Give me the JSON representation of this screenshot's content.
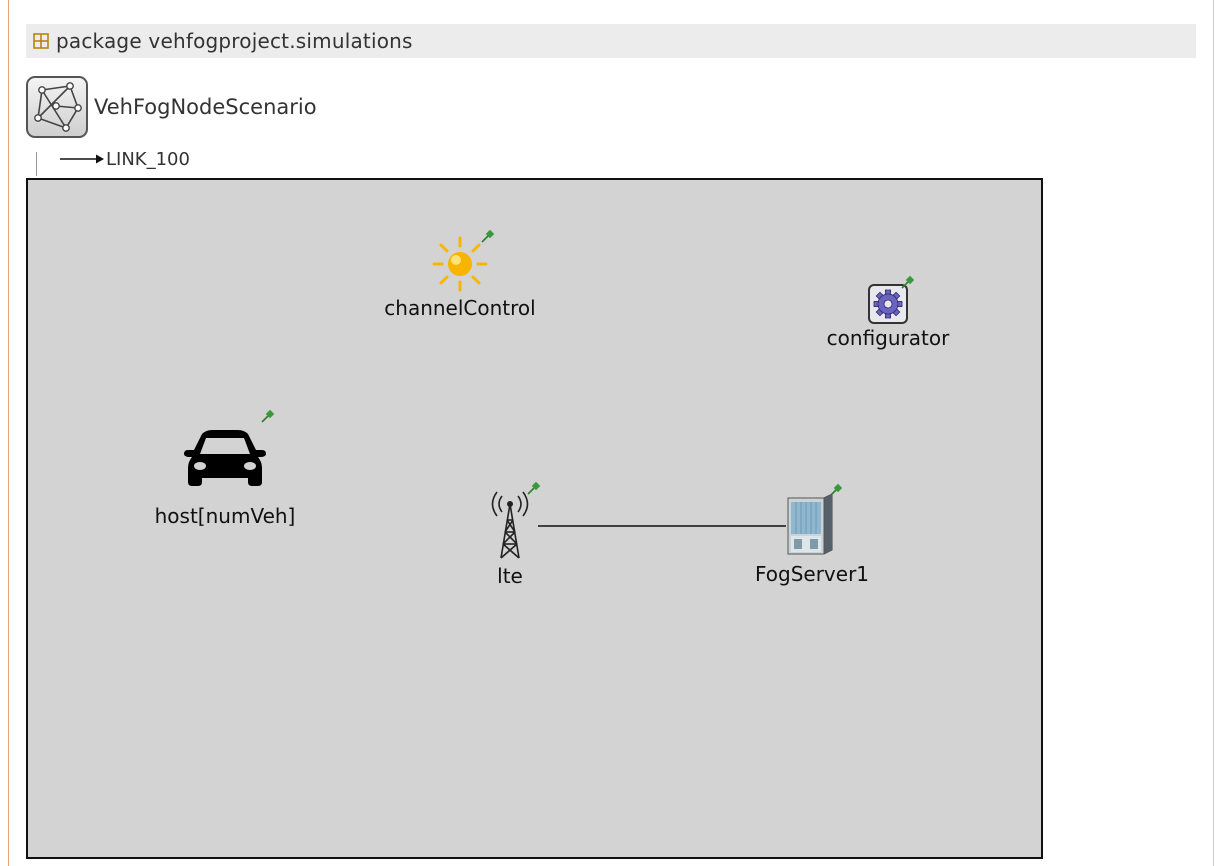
{
  "package": {
    "keyword": "package",
    "name": "vehfogproject.simulations",
    "icon": "package-icon"
  },
  "module": {
    "name": "VehFogNodeScenario",
    "icon": "network-icon"
  },
  "link": {
    "label": "LINK_100",
    "icon": "arrow-right-icon"
  },
  "nodes": {
    "channelControl": {
      "label": "channelControl",
      "icon": "sun-icon"
    },
    "configurator": {
      "label": "configurator",
      "icon": "gear-icon"
    },
    "host": {
      "label": "host[numVeh]",
      "icon": "car-icon"
    },
    "lte": {
      "label": "lte",
      "icon": "antenna-tower-icon"
    },
    "fogServer": {
      "label": "FogServer1",
      "icon": "server-icon"
    }
  },
  "connections": [
    {
      "from": "lte",
      "to": "FogServer1"
    }
  ],
  "colors": {
    "canvas_background": "#d3d3d3",
    "pin": "#3a9a3a",
    "sun": "#f7b500"
  }
}
